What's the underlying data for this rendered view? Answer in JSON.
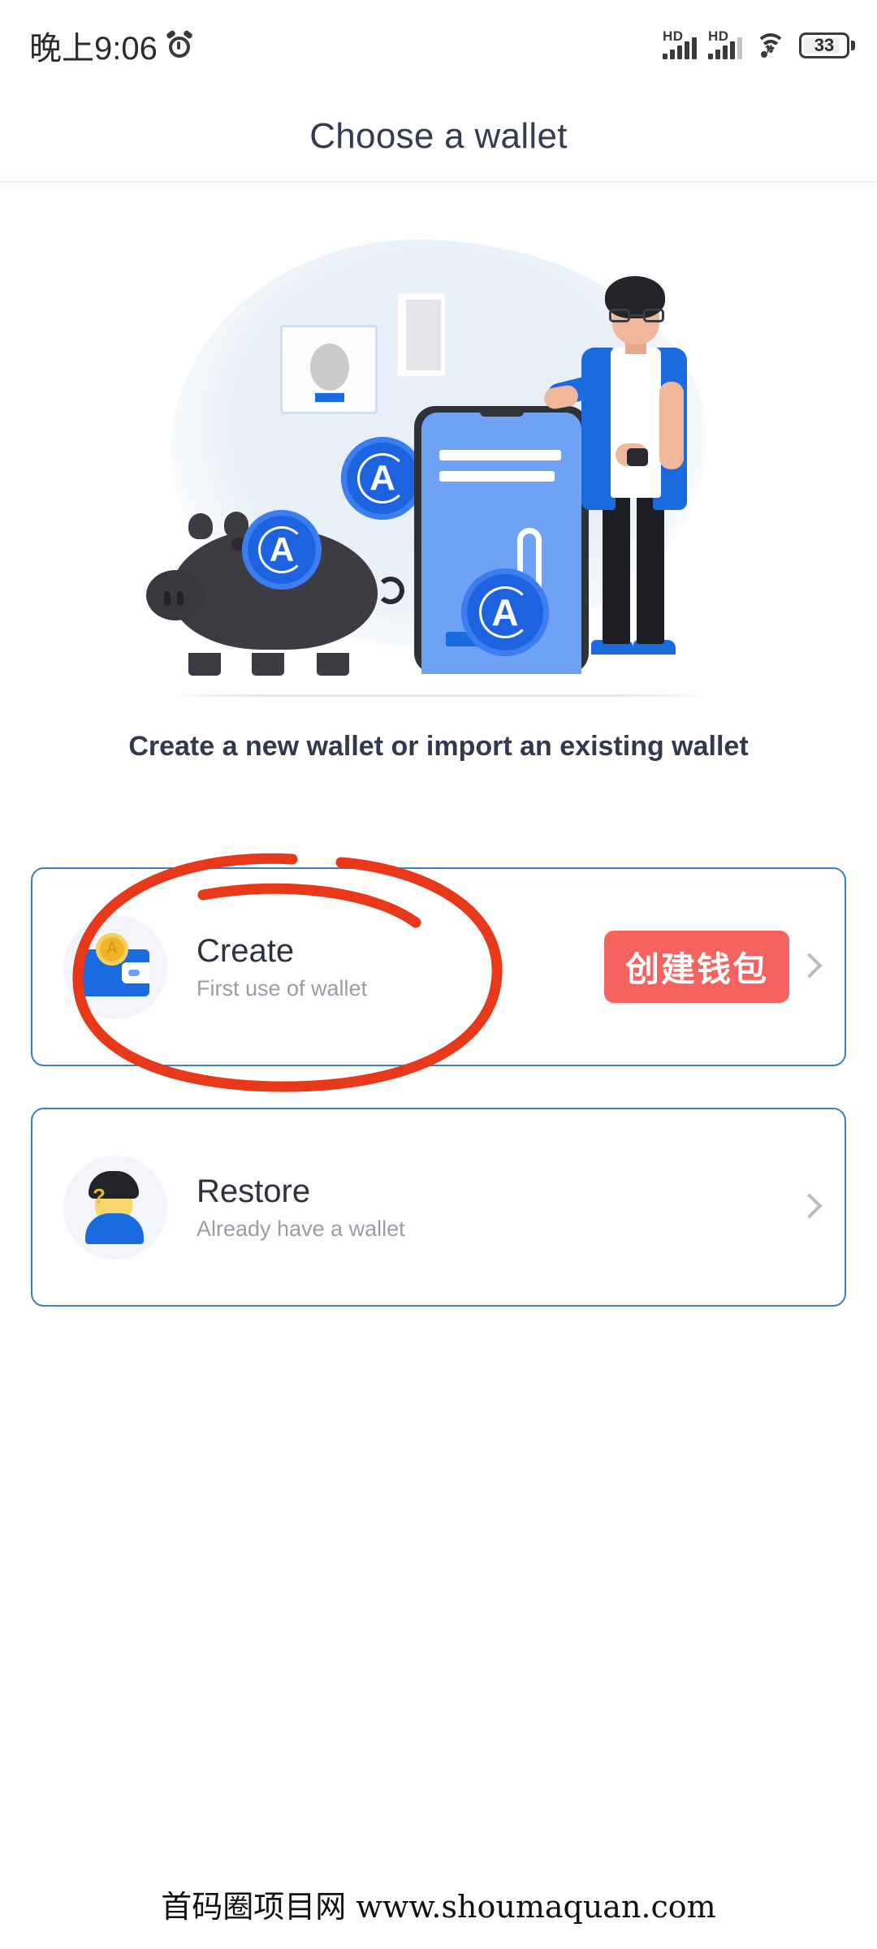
{
  "statusbar": {
    "time": "晚上9:06",
    "alarm_icon": "alarm-clock-icon",
    "signal1_label": "HD",
    "signal2_label": "HD",
    "wifi_icon": "wifi-icon",
    "battery_level": "33"
  },
  "header": {
    "title": "Choose a wallet"
  },
  "hero": {
    "illustration_name": "wallet-onboarding-illustration",
    "coin_glyph": "A"
  },
  "subtitle": "Create a new wallet or import an existing wallet",
  "options": [
    {
      "title": "Create",
      "subtitle": "First use of wallet",
      "icon": "wallet-icon",
      "badge": "创建钱包",
      "coin_glyph": "A"
    },
    {
      "title": "Restore",
      "subtitle": "Already have a wallet",
      "icon": "user-avatar-icon",
      "badge": "",
      "avatar_mark": "?"
    }
  ],
  "annotation": {
    "name": "red-circle-highlight",
    "color": "#e8381a"
  },
  "footer": "首码圈项目网 www.shoumaquan.com",
  "colors": {
    "accent_blue": "#1a6ae0",
    "card_border": "#3a7fc4",
    "badge_red": "#f4635f",
    "title_text": "#363b52"
  }
}
